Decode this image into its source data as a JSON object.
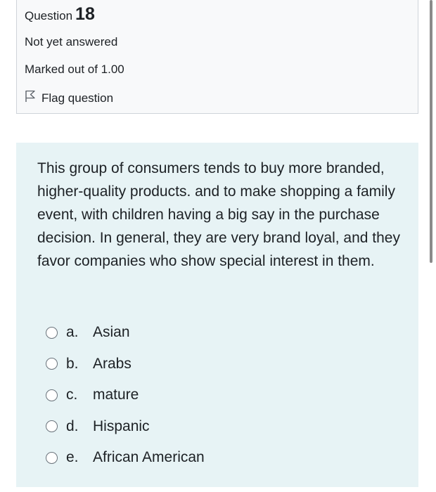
{
  "info": {
    "question_label": "Question",
    "question_number": "18",
    "state": "Not yet answered",
    "grade": "Marked out of 1.00",
    "flag_label": "Flag question"
  },
  "question": {
    "text": "This group of consumers tends to buy more branded, higher-quality products. and to make shopping a family event, with children having a big say in the purchase decision. In general, they are very brand loyal, and they favor companies who show special interest in them."
  },
  "answers": [
    {
      "letter": "a.",
      "label": "Asian",
      "selected": false
    },
    {
      "letter": "b.",
      "label": "Arabs",
      "selected": false
    },
    {
      "letter": "c.",
      "label": "mature",
      "selected": false
    },
    {
      "letter": "d.",
      "label": "Hispanic",
      "selected": false
    },
    {
      "letter": "e.",
      "label": "African American",
      "selected": false
    }
  ],
  "colors": {
    "info_background": "#f8f9fa",
    "content_background": "#e7f3f5",
    "text": "#1d2125"
  }
}
